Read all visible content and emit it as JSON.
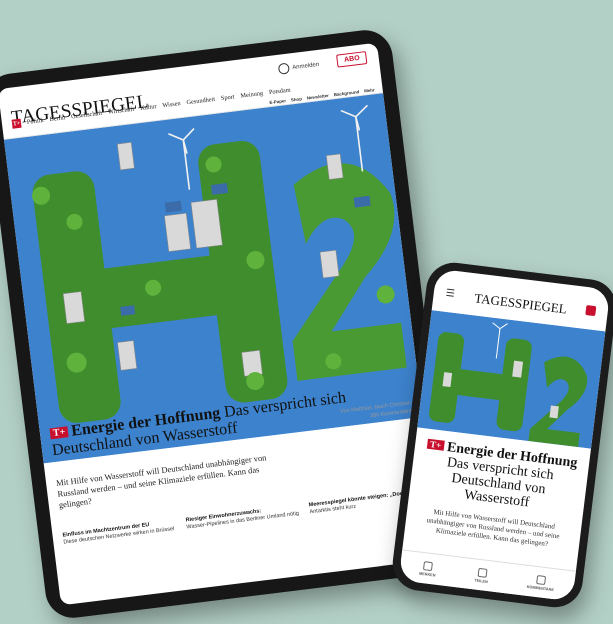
{
  "tablet": {
    "logo": "TAGESSPIEGEL",
    "user_label": "Anmelden",
    "abo_label": "ABO",
    "nav_badge": "T+",
    "nav": [
      "Politik",
      "Berlin",
      "Gesellschaft",
      "Wirtschaft",
      "Kultur",
      "Wissen",
      "Gesundheit",
      "Sport",
      "Meinung",
      "Potsdam"
    ],
    "subnav": [
      "E-Paper",
      "Shop",
      "Newsletter",
      "Background",
      "Mehr"
    ],
    "headline": {
      "badge": "T+",
      "bold": "Energie der Hoffnung",
      "rest": "Das verspricht sich Deutschland von Wasserstoff"
    },
    "meta": {
      "author": "Von Matthias Jauch Christian",
      "comments": "386 Kommentare"
    },
    "teaser": "Mit Hilfe von Wasserstoff will Deutschland unabhängiger von Russland werden – und seine Klimaziele erfüllen. Kann das gelingen?",
    "columns": [
      {
        "title": "Einfluss im Machtzentrum der EU",
        "text": "Diese deutschen Netzwerke wirken in Brüssel"
      },
      {
        "title": "Riesiger Einwohnerzuwachs:",
        "text": "Wasser-Pipelines in das Berliner Umland nötig"
      },
      {
        "title": "Meeresspiegel könnte steigen: „Doomsday\"",
        "text": "Antarktis steht kurz"
      }
    ]
  },
  "phone": {
    "logo": "TAGESSPIEGEL",
    "headline": {
      "badge": "T+",
      "bold": "Energie der Hoffnung",
      "rest": "Das verspricht sich Deutschland von Wasserstoff"
    },
    "teaser": "Mit Hilfe von Wasserstoff will Deutschland unabhängiger von Russland werden – und seine Klimaziele erfüllen. Kann das gelingen?",
    "tabs": [
      "MERKEN",
      "TEILEN",
      "KOMMENTARE"
    ]
  },
  "colors": {
    "background": "#b3d0c6",
    "brand_red": "#c8102e",
    "sky": "#2b6fc2",
    "foliage": "#3f8d2c"
  }
}
